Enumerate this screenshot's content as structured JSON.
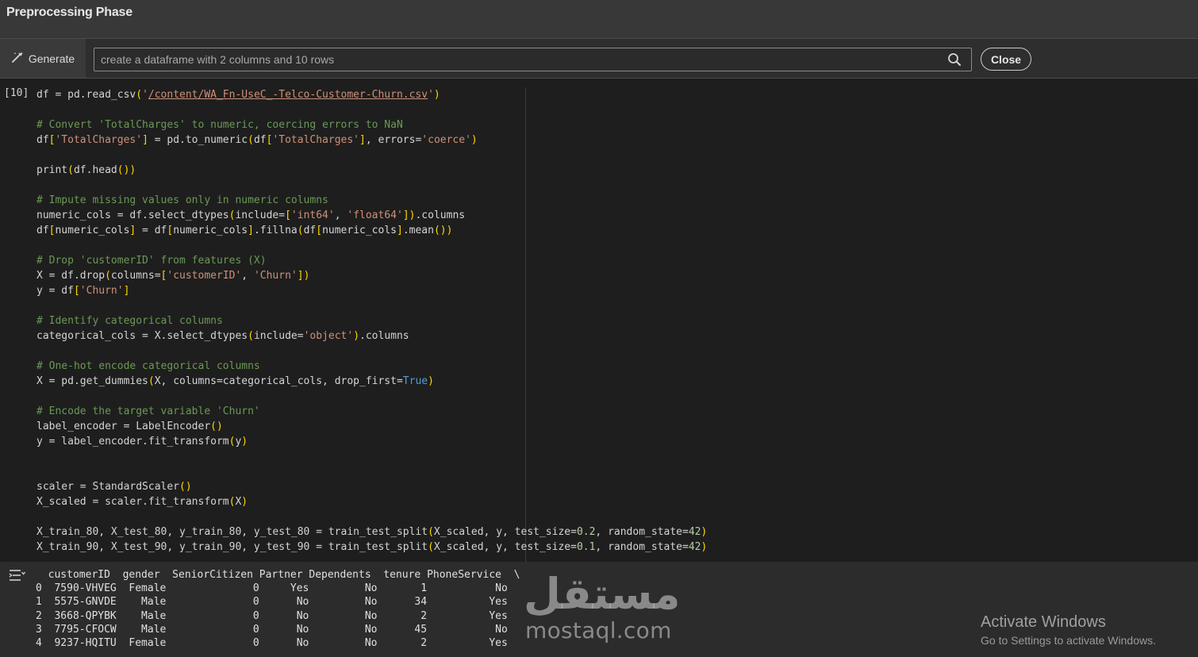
{
  "window": {
    "title": "Preprocessing Phase"
  },
  "toolbar": {
    "generate_label": "Generate",
    "prompt_placeholder": "create a dataframe with 2 columns and 10 rows",
    "close_label": "Close"
  },
  "cell": {
    "execution_count": "[10]",
    "file_path": "/content/WA_Fn-UseC_-Telco-Customer-Churn.csv",
    "code_lines": [
      "df = pd.read_csv('/content/WA_Fn-UseC_-Telco-Customer-Churn.csv')",
      "",
      "# Convert 'TotalCharges' to numeric, coercing errors to NaN",
      "df['TotalCharges'] = pd.to_numeric(df['TotalCharges'], errors='coerce')",
      "",
      "print(df.head())",
      "",
      "# Impute missing values only in numeric columns",
      "numeric_cols = df.select_dtypes(include=['int64', 'float64']).columns",
      "df[numeric_cols] = df[numeric_cols].fillna(df[numeric_cols].mean())",
      "",
      "# Drop 'customerID' from features (X)",
      "X = df.drop(columns=['customerID', 'Churn'])",
      "y = df['Churn']",
      "",
      "# Identify categorical columns",
      "categorical_cols = X.select_dtypes(include='object').columns",
      "",
      "# One-hot encode categorical columns",
      "X = pd.get_dummies(X, columns=categorical_cols, drop_first=True)",
      "",
      "# Encode the target variable 'Churn'",
      "label_encoder = LabelEncoder()",
      "y = label_encoder.fit_transform(y)",
      "",
      "",
      "scaler = StandardScaler()",
      "X_scaled = scaler.fit_transform(X)",
      "",
      "X_train_80, X_test_80, y_train_80, y_test_80 = train_test_split(X_scaled, y, test_size=0.2, random_state=42)",
      "X_train_90, X_test_90, y_train_90, y_test_90 = train_test_split(X_scaled, y, test_size=0.1, random_state=42)"
    ]
  },
  "output": {
    "lines": [
      "  customerID  gender  SeniorCitizen Partner Dependents  tenure PhoneService  \\",
      "0  7590-VHVEG  Female              0     Yes         No       1           No   ",
      "1  5575-GNVDE    Male              0      No         No      34          Yes   ",
      "2  3668-QPYBK    Male              0      No         No       2          Yes   ",
      "3  7795-CFOCW    Male              0      No         No      45           No   ",
      "4  9237-HQITU  Female              0      No         No       2          Yes   "
    ]
  },
  "watermark": {
    "arabic": "مستقل",
    "latin": "mostaql.com"
  },
  "os_notice": {
    "title": "Activate Windows",
    "subtitle": "Go to Settings to activate Windows."
  },
  "icons": {
    "generate": "magic-wand-icon",
    "search": "search-icon",
    "output": "output-collapse-icon"
  },
  "colors": {
    "comment": "#6a9955",
    "string": "#ce9178",
    "bracket": "#ffd700",
    "keyword_const": "#569cd6",
    "number": "#b5cea8"
  }
}
